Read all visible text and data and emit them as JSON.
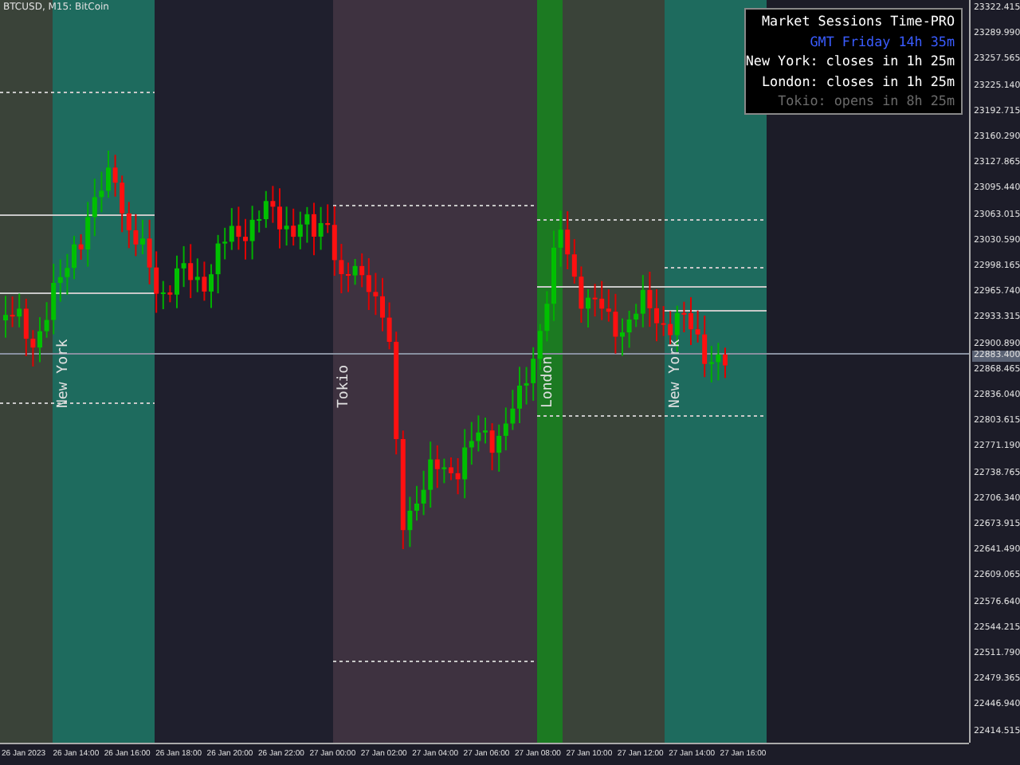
{
  "symbol_label": "BTCUSD, M15: BitCoin",
  "sessions": [
    {
      "color": "#3a4339"
    },
    {
      "label": "New York",
      "color": "#1e6b5e"
    },
    {
      "color": "#1f1f2d"
    },
    {
      "label": "Tokio",
      "color": "#3e3240"
    },
    {
      "label": "London",
      "color": "#1c7a22"
    },
    {
      "color": "#3a4339"
    },
    {
      "label": "New York",
      "color": "#1e6b5e"
    }
  ],
  "info_panel": {
    "title": "Market Sessions Time-PRO",
    "lines": [
      {
        "text": "GMT Friday 14h 35m",
        "color": "#3a5cff"
      },
      {
        "text": "New York: closes in 1h 25m",
        "color": "#ffffff"
      },
      {
        "text": "London: closes in 1h 25m",
        "color": "#ffffff"
      },
      {
        "text": "Tokio: opens in 8h 25m",
        "color": "#6a6a6a"
      }
    ]
  },
  "price_axis": [
    "23322.415",
    "23289.990",
    "23257.565",
    "23225.140",
    "23192.715",
    "23160.290",
    "23127.865",
    "23095.440",
    "23063.015",
    "23030.590",
    "22998.165",
    "22965.740",
    "22933.315",
    "22900.890",
    "22868.465",
    "22836.040",
    "22803.615",
    "22771.190",
    "22738.765",
    "22706.340",
    "22673.915",
    "22641.490",
    "22609.065",
    "22576.640",
    "22544.215",
    "22511.790",
    "22479.365",
    "22446.940",
    "22414.515"
  ],
  "current_price": "22883.400",
  "time_axis": [
    "26 Jan 2023",
    "26 Jan 14:00",
    "26 Jan 16:00",
    "26 Jan 18:00",
    "26 Jan 20:00",
    "26 Jan 22:00",
    "27 Jan 00:00",
    "27 Jan 02:00",
    "27 Jan 04:00",
    "27 Jan 06:00",
    "27 Jan 08:00",
    "27 Jan 10:00",
    "27 Jan 12:00",
    "27 Jan 14:00",
    "27 Jan 16:00"
  ]
}
